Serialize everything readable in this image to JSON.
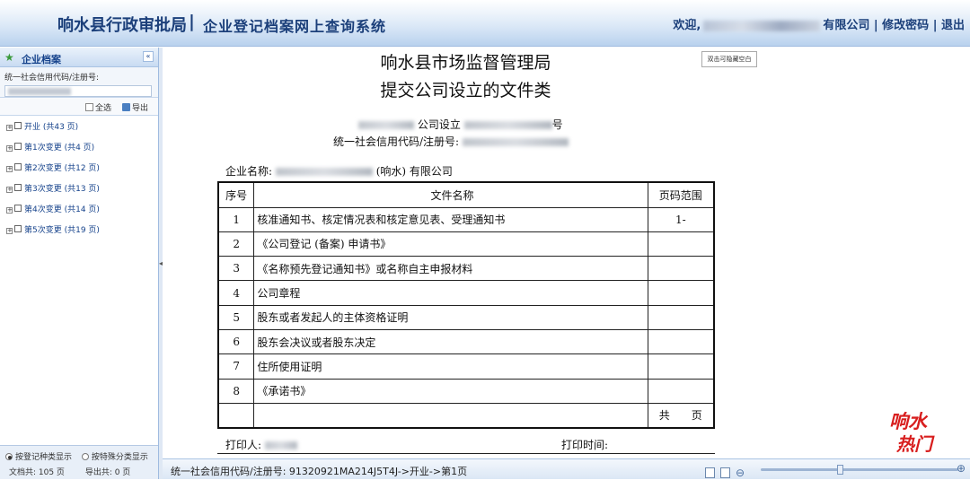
{
  "header": {
    "title": "响水县行政审批局",
    "separator": "|",
    "subtitle": "企业登记档案网上查询系统",
    "welcome": "欢迎,",
    "company_suffix": "有限公司",
    "change_password": "修改密码",
    "logout": "退出",
    "divider": "|"
  },
  "sidebar": {
    "panel_title": "企业档案",
    "search_label": "统一社会信用代码/注册号:",
    "select_all": "全选",
    "export": "导出",
    "items": [
      {
        "label": "开业 (共43 页)"
      },
      {
        "label": "第1次变更 (共4 页)"
      },
      {
        "label": "第2次变更 (共12 页)"
      },
      {
        "label": "第3次变更 (共13 页)"
      },
      {
        "label": "第4次变更 (共14 页)"
      },
      {
        "label": "第5次变更 (共19 页)"
      }
    ],
    "radio_category": "按登记种类显示",
    "radio_special": "按特殊分类显示",
    "doc_total": "文档共: 105 页",
    "export_total": "导出共: 0 页"
  },
  "document": {
    "title_line1": "响水县市场监督管理局",
    "title_line2": "提交公司设立的文件类",
    "hide_blank_btn": "双击可隐藏空白",
    "company_setup_mid": "公司设立",
    "number_suffix": "号",
    "credit_code_label": "统一社会信用代码/注册号:",
    "company_name_label": "企业名称:",
    "company_name_tail": "(响水) 有限公司",
    "table_headers": {
      "seq": "序号",
      "name": "文件名称",
      "pages": "页码范围"
    },
    "rows": [
      {
        "seq": "1",
        "name": "核准通知书、核定情况表和核定意见表、受理通知书",
        "pages": "1-"
      },
      {
        "seq": "2",
        "name": "《公司登记 (备案) 申请书》",
        "pages": ""
      },
      {
        "seq": "3",
        "name": "《名称预先登记通知书》或名称自主申报材料",
        "pages": ""
      },
      {
        "seq": "4",
        "name": "公司章程",
        "pages": ""
      },
      {
        "seq": "5",
        "name": "股东或者发起人的主体资格证明",
        "pages": ""
      },
      {
        "seq": "6",
        "name": "股东会决议或者股东决定",
        "pages": ""
      },
      {
        "seq": "7",
        "name": "住所使用证明",
        "pages": ""
      },
      {
        "seq": "8",
        "name": "《承诺书》",
        "pages": ""
      },
      {
        "seq": "",
        "name": "",
        "pages": "共　　页"
      }
    ],
    "printer_label": "打印人:",
    "print_time_label": "打印时间:"
  },
  "status": {
    "path": "统一社会信用代码/注册号: 91320921MA214J5T4J->开业->第1页",
    "zoom_level": 0.4
  },
  "watermark": {
    "line1": "响水",
    "line2": "热门"
  },
  "colors": {
    "header_text": "#1b3f7a",
    "accent": "#15428b",
    "watermark": "#d81e1e"
  }
}
